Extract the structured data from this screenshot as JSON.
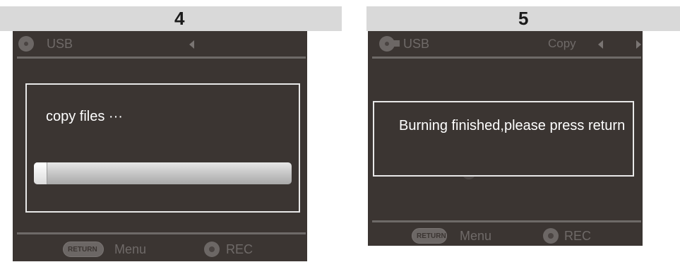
{
  "steps": {
    "left": "4",
    "right": "5"
  },
  "screen4": {
    "source": "USB",
    "dialog_message": "copy files ···",
    "progress": 0.05,
    "footer": {
      "return_label": "RETURN",
      "menu_label": "Menu",
      "rec_label": "REC"
    },
    "icons": {
      "source": "disc-icon",
      "nav": "triangle-left-icon"
    }
  },
  "screen5": {
    "source": "USB",
    "mode": "Copy",
    "dialog_message": "Burning finished,please press return",
    "footer": {
      "return_label": "RETURN",
      "menu_label": "Menu",
      "rec_label": "REC"
    },
    "icons": {
      "source": "usb-disc-icon",
      "nav_left": "triangle-left-icon",
      "nav_right": "triangle-right-icon"
    }
  },
  "colors": {
    "screen_bg": "#3b3532",
    "header_bar": "#d9d9d9",
    "dim_text": "#6f6a68",
    "dialog_border": "#e8e8e8"
  }
}
